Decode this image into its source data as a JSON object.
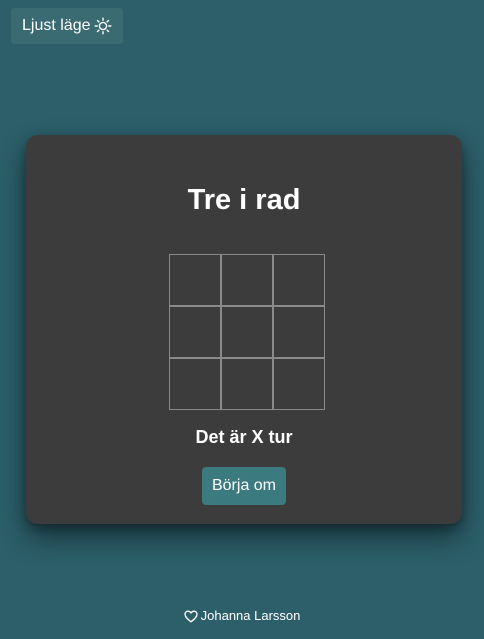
{
  "theme_toggle": {
    "label": "Ljust läge",
    "icon": "sun-icon"
  },
  "game": {
    "title": "Tre i rad",
    "board": [
      "",
      "",
      "",
      "",
      "",
      "",
      "",
      "",
      ""
    ],
    "status": "Det är X tur",
    "restart_label": "Börja om"
  },
  "footer": {
    "icon": "heart-icon",
    "author": "Johanna Larsson"
  },
  "colors": {
    "background": "#2c5f6a",
    "card": "#3c3c3c",
    "button": "#3b7a7e",
    "toggle": "#3a6b73",
    "grid_line": "#8a8a8a"
  }
}
